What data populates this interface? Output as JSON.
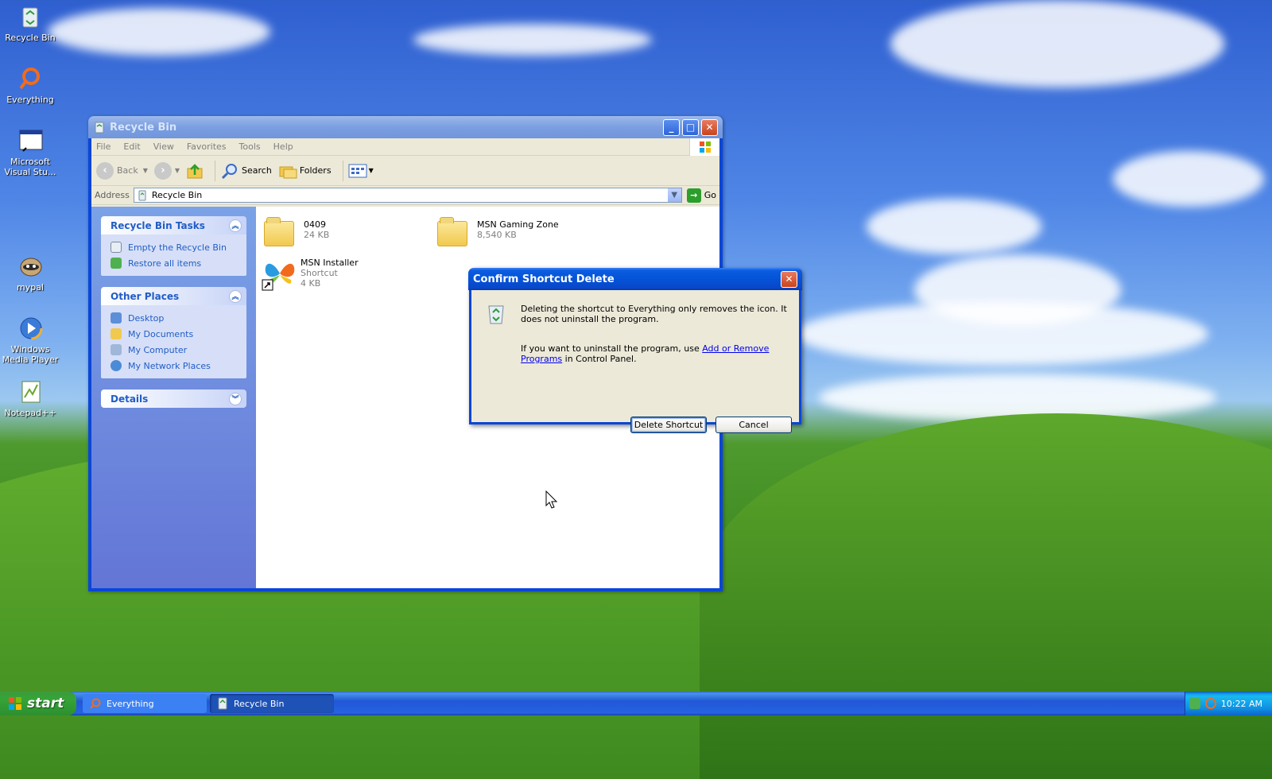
{
  "desktop": {
    "icons": [
      {
        "label": "Recycle Bin",
        "icon": "recycle-bin-icon"
      },
      {
        "label": "Everything",
        "icon": "everything-icon"
      },
      {
        "label": "Microsoft Visual Stu...",
        "icon": "visual-studio-icon"
      },
      {
        "label": "mypal",
        "icon": "mypal-icon"
      },
      {
        "label": "Windows Media Player",
        "icon": "media-player-icon"
      },
      {
        "label": "Notepad++",
        "icon": "notepadpp-icon"
      }
    ]
  },
  "window": {
    "title": "Recycle Bin",
    "menu": [
      "File",
      "Edit",
      "View",
      "Favorites",
      "Tools",
      "Help"
    ],
    "toolbar": {
      "back": "Back",
      "search": "Search",
      "folders": "Folders"
    },
    "address": {
      "label": "Address",
      "value": "Recycle Bin",
      "go": "Go"
    },
    "tasks_panel": {
      "title": "Recycle Bin Tasks",
      "items": [
        "Empty the Recycle Bin",
        "Restore all items"
      ]
    },
    "places_panel": {
      "title": "Other Places",
      "items": [
        "Desktop",
        "My Documents",
        "My Computer",
        "My Network Places"
      ]
    },
    "details_panel": {
      "title": "Details"
    },
    "files": [
      {
        "name": "0409",
        "sub": "24 KB"
      },
      {
        "name": "MSN Gaming Zone",
        "sub": "8,540 KB"
      },
      {
        "name": "MSN Installer",
        "sub": "Shortcut",
        "sub2": "4 KB"
      }
    ]
  },
  "dialog": {
    "title": "Confirm Shortcut Delete",
    "line1": "Deleting the shortcut to Everything only removes the icon. It does not uninstall the program.",
    "line2_pre": "If you want to uninstall the program, use ",
    "line2_link": "Add or Remove Programs",
    "line2_post": " in Control Panel.",
    "primary": "Delete Shortcut",
    "secondary": "Cancel"
  },
  "taskbar": {
    "start": "start",
    "tasks": [
      {
        "label": "Everything",
        "active": false
      },
      {
        "label": "Recycle Bin",
        "active": true
      }
    ],
    "clock": "10:22 AM"
  },
  "colors": {
    "accent": "#0a46d8",
    "link": "#215dc6",
    "start_green": "#35a537"
  }
}
